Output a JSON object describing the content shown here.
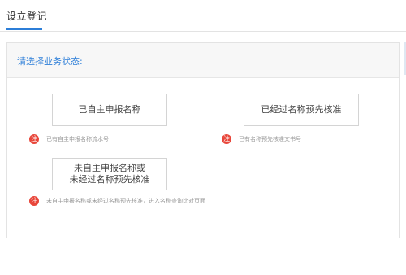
{
  "tabs": [
    {
      "label": "设立登记",
      "active": true
    }
  ],
  "panel": {
    "title": "请选择业务状态:",
    "options": [
      {
        "label": "已自主申报名称",
        "note": "已有自主申报名称流水号"
      },
      {
        "label": "已经过名称预先核准",
        "note": "已有名称预先核准文书号"
      },
      {
        "label_line1": "未自主申报名称或",
        "label_line2": "未经过名称预先核准",
        "note": "未自主申报名称或未经过名称预先核准，进入名称查询比对页面"
      }
    ],
    "note_badge": "注"
  },
  "colors": {
    "accent": "#2c7ed8",
    "badge": "#e8463a"
  }
}
